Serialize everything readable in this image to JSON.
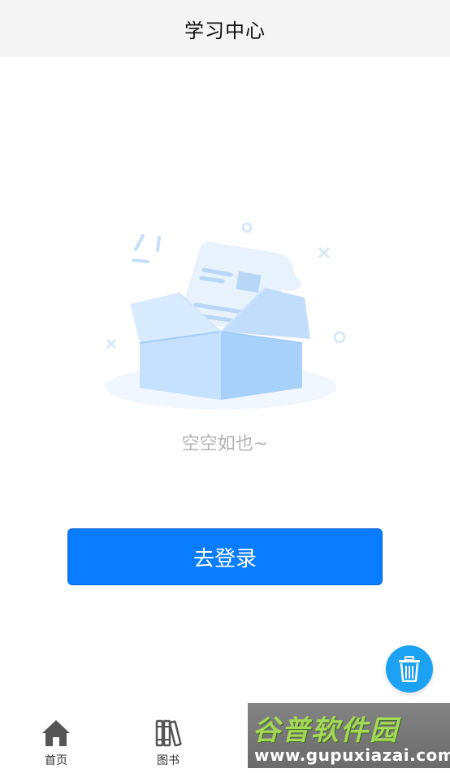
{
  "header": {
    "title": "学习中心"
  },
  "empty_state": {
    "message": "空空如也~",
    "illustration": "empty-box-illustration"
  },
  "login_button": {
    "label": "去登录"
  },
  "fab": {
    "icon": "trash-icon",
    "color": "#1da1f2"
  },
  "tabbar": {
    "items": [
      {
        "label": "首页",
        "icon": "home-icon"
      },
      {
        "label": "图书",
        "icon": "books-icon"
      }
    ]
  },
  "watermark": {
    "title": "谷普软件园",
    "url": "www.gupuxiazai.com"
  },
  "colors": {
    "accent": "#0a7cff",
    "header_bg": "#f5f5f5",
    "empty_text": "#b3b3b3"
  }
}
